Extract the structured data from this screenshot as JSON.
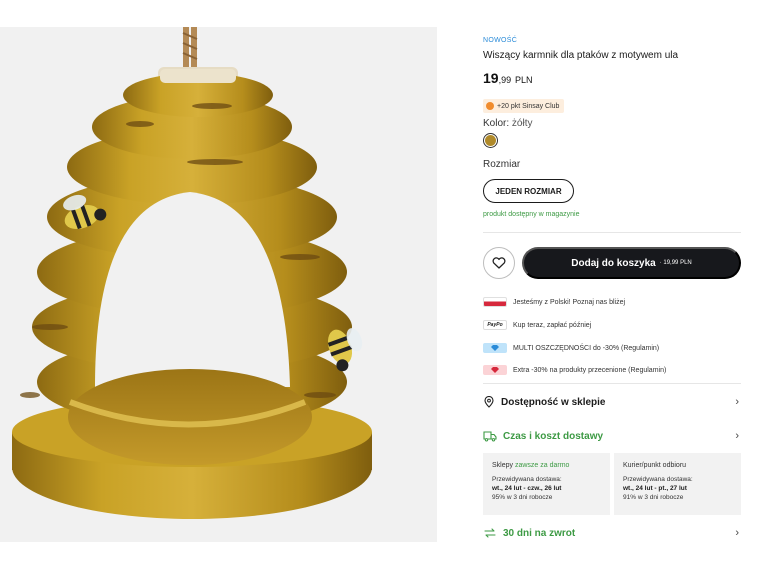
{
  "product": {
    "badge_new": "NOWOŚĆ",
    "title": "Wiszący karmnik dla ptaków z motywem ula",
    "price_main": "19",
    "price_decimal": ",99",
    "price_currency": "PLN",
    "club_points": "+20 pkt Sinsay Club",
    "color_label": "Kolor:",
    "color_value": "żółty",
    "size_label": "Rozmiar",
    "size_option": "JEDEN ROZMIAR",
    "availability": "produkt dostępny w magazynie"
  },
  "actions": {
    "favorite_icon": "heart-icon",
    "add_to_cart": "Dodaj do koszyka",
    "add_to_cart_price": "· 19,99 PLN"
  },
  "promos": [
    {
      "icon": "polish-flag-icon",
      "text": "Jesteśmy z Polski! Poznaj nas bliżej"
    },
    {
      "icon": "paypo-icon",
      "icon_text": "PayPo",
      "text": "Kup teraz, zapłać później"
    },
    {
      "icon": "multi-diamond-icon",
      "text": "MULTI OSZCZĘDNOŚCI do -30% (Regulamin)"
    },
    {
      "icon": "extra-tag-icon",
      "text": "Extra -30% na produkty przecenione (Regulamin)"
    }
  ],
  "links": {
    "store_availability": "Dostępność w sklepie",
    "delivery_time_cost": "Czas i koszt dostawy",
    "returns": "30 dni na zwrot"
  },
  "delivery": {
    "stores": {
      "label": "Sklepy",
      "free": "zawsze za darmo",
      "expected_label": "Przewidywana dostawa:",
      "dates": "wt., 24 lut - czw., 26 lut",
      "rate": "95% w 3 dni robocze"
    },
    "courier": {
      "label": "Kurier/punkt odbioru",
      "expected_label": "Przewidywana dostawa:",
      "dates": "wt., 24 lut - pt., 27 lut",
      "rate": "91% w 3 dni robocze"
    }
  },
  "colors": {
    "accent_new": "#2a8bd8",
    "available_green": "#3d9a44",
    "cart_button": "#17181c",
    "product_yellow": "#c9a226"
  }
}
